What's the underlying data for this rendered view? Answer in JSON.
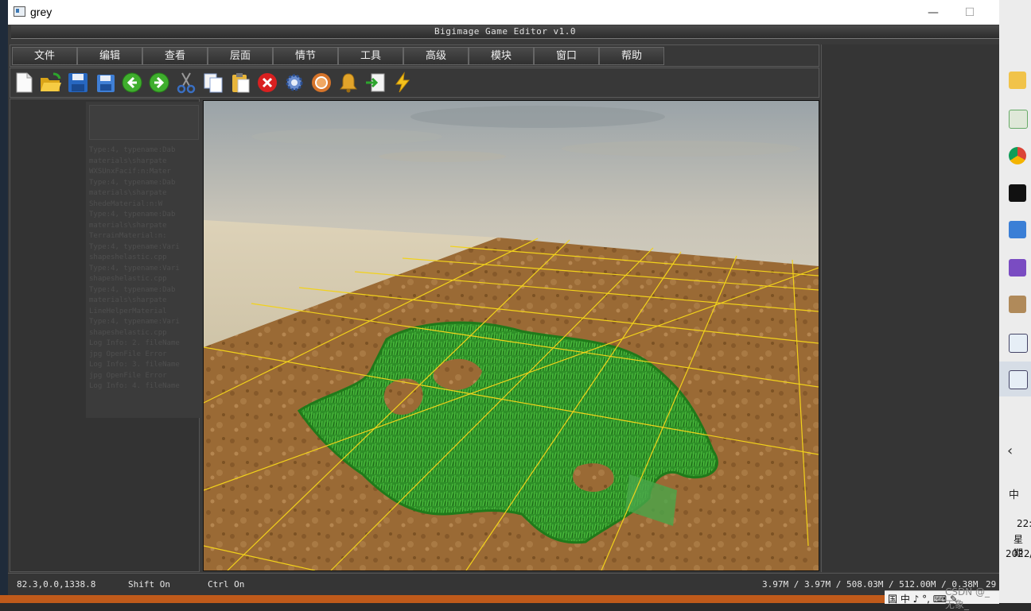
{
  "window": {
    "title": "grey",
    "minimize": "—",
    "maximize": "☐"
  },
  "editor": {
    "title": "Bigimage Game Editor v1.0"
  },
  "menu": [
    "文件",
    "编辑",
    "查看",
    "层面",
    "情节",
    "工具",
    "高级",
    "模块",
    "窗口",
    "帮助"
  ],
  "toolbar": [
    {
      "name": "new-file-icon"
    },
    {
      "name": "open-folder-icon"
    },
    {
      "name": "save-icon"
    },
    {
      "name": "save-as-icon"
    },
    {
      "name": "back-arrow-icon"
    },
    {
      "name": "forward-arrow-icon"
    },
    {
      "name": "cut-icon"
    },
    {
      "name": "copy-icon"
    },
    {
      "name": "paste-icon"
    },
    {
      "name": "delete-icon"
    },
    {
      "name": "settings-gear-icon"
    },
    {
      "name": "render-icon"
    },
    {
      "name": "bell-icon"
    },
    {
      "name": "export-icon"
    },
    {
      "name": "lightning-icon"
    }
  ],
  "log_lines": [
    "Type:4, typename:Dab",
    "materials\\sharpate",
    "WXSUnxFacif:n:Mater",
    "Type:4, typename:Dab",
    "materials\\sharpate",
    "ShedeMaterial:n:W",
    "Type:4, typename:Dab",
    "materials\\sharpate",
    "TerrainMaterial:n:",
    "Type:4, typename:Vari",
    "shapeshelastic.cpp",
    "Type:4, typename:Vari",
    "shapeshelastic.cpp",
    "Type:4, typename:Dab",
    "materials\\sharpate",
    "LineHelperMaterial",
    "Type:4, typename:Vari",
    "shapeshelastic.cpp",
    "Log Info: 2. fileName",
    "jpg OpenFile Error",
    "Log Info: 3. fileName",
    "jpg OpenFile Error",
    "Log Info: 4. fileName"
  ],
  "status": {
    "coords": "82.3,0.0,1338.8",
    "shift": "Shift On",
    "ctrl": "Ctrl On",
    "memory": "3.97M / 3.97M / 508.03M / 512.00M / 0.38M",
    "fps": "29"
  },
  "taskbar": {
    "time": "22:",
    "weekday": "星期",
    "year": "2022/",
    "ime": "中",
    "chevron": "‹"
  },
  "ime_bar": {
    "items": "国 中 ♪ °, ⌨ ✎",
    "watermark": "CSDN @_无象_"
  },
  "colors": {
    "grid": "#f2d21b",
    "grass": "#2f8f2a",
    "ground": "#9a6a35",
    "sky": "#d6d0c0"
  }
}
